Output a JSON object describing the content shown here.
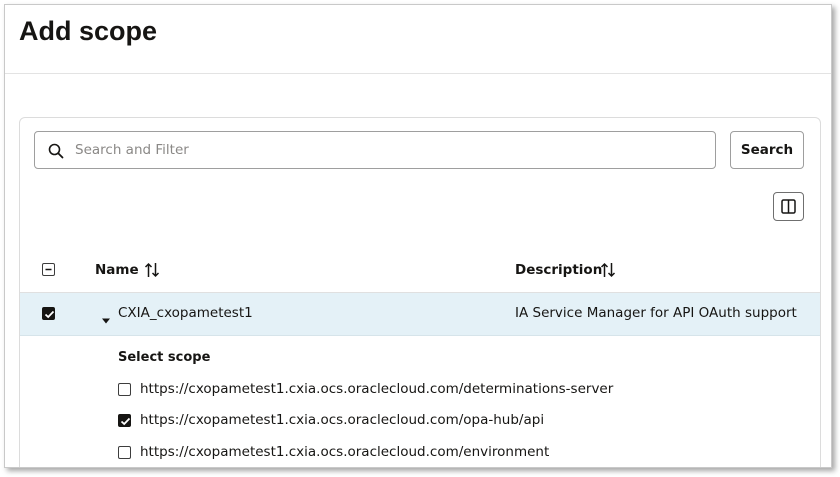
{
  "dialog": {
    "title": "Add scope"
  },
  "search": {
    "placeholder": "Search and Filter",
    "value": "",
    "button_label": "Search"
  },
  "table": {
    "columns": [
      {
        "label": "Name",
        "sortable": true
      },
      {
        "label": "Description",
        "sortable": true
      }
    ],
    "select_all_state": "mixed",
    "rows": [
      {
        "name": "CXIA_cxopametest1",
        "description": "IA Service Manager for API OAuth support",
        "checked": true,
        "expanded": true
      }
    ]
  },
  "scopes": {
    "label": "Select scope",
    "items": [
      {
        "url": "https://cxopametest1.cxia.ocs.oraclecloud.com/determinations-server",
        "checked": false
      },
      {
        "url": "https://cxopametest1.cxia.ocs.oraclecloud.com/opa-hub/api",
        "checked": true
      },
      {
        "url": "https://cxopametest1.cxia.ocs.oraclecloud.com/environment",
        "checked": false
      }
    ]
  },
  "icons": {
    "search": "search-icon",
    "columns": "columns-icon",
    "sort": "sort-icon",
    "caret": "caret-down-icon"
  },
  "colors": {
    "selected_row": "#e4f1f7",
    "text": "#161513",
    "placeholder": "#8a8886"
  }
}
